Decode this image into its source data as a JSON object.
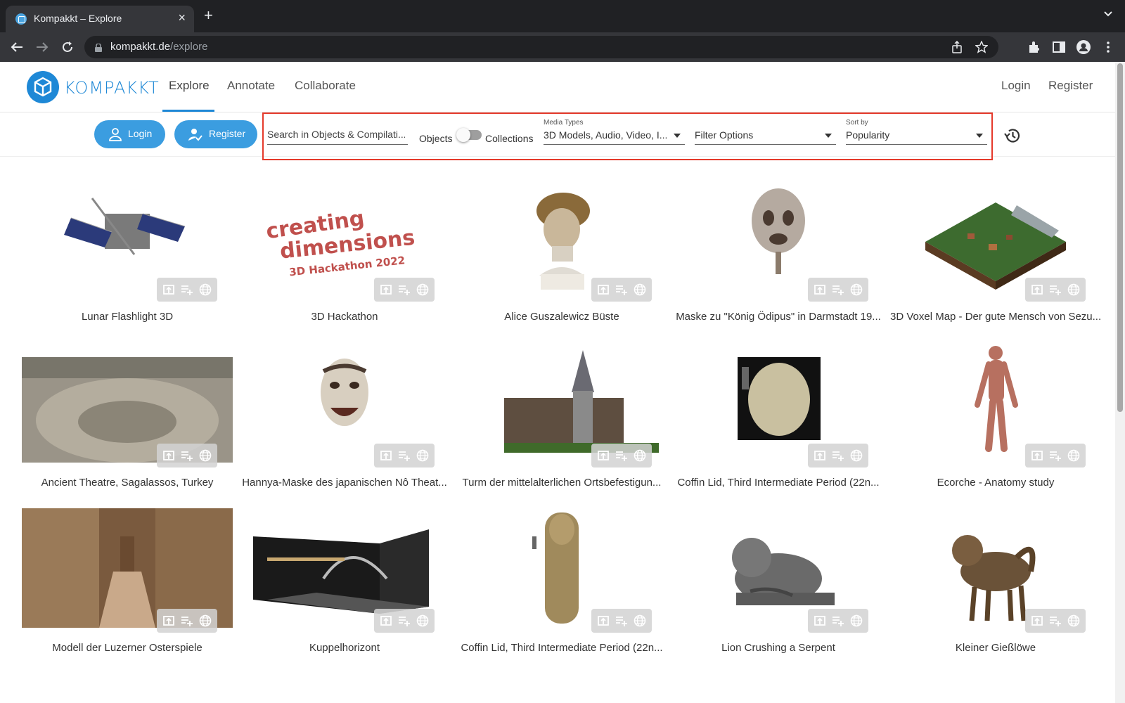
{
  "browser": {
    "tab_title": "Kompakkt – Explore",
    "url_host": "kompakkt.de",
    "url_path": "/explore"
  },
  "header": {
    "logo_text": "KOMPAKKT",
    "nav": [
      "Explore",
      "Annotate",
      "Collaborate"
    ],
    "login": "Login",
    "register": "Register"
  },
  "filters": {
    "login_button": "Login",
    "register_button": "Register",
    "search_placeholder": "Search in Objects & Compilati...",
    "toggle_left": "Objects",
    "toggle_right": "Collections",
    "media_types_label": "Media Types",
    "media_types_value": "3D Models, Audio, Video, I...",
    "filter_options_value": "Filter Options",
    "sort_by_label": "Sort by",
    "sort_by_value": "Popularity"
  },
  "items": [
    {
      "title": "Lunar Flashlight 3D",
      "thumb": "satellite"
    },
    {
      "title": "3D Hackathon",
      "thumb": "hackathon"
    },
    {
      "title": "Alice Guszalewicz Büste",
      "thumb": "bust"
    },
    {
      "title": "Maske zu \"König Ödipus\" in Darmstadt 19...",
      "thumb": "mask-oedipus"
    },
    {
      "title": "3D Voxel Map - Der gute Mensch von Sezu...",
      "thumb": "voxel-map"
    },
    {
      "title": "Ancient Theatre, Sagalassos, Turkey",
      "thumb": "theatre"
    },
    {
      "title": "Hannya-Maske des japanischen Nô Theat...",
      "thumb": "hannya-mask"
    },
    {
      "title": "Turm der mittelalterlichen Ortsbefestigun...",
      "thumb": "tower"
    },
    {
      "title": "Coffin Lid, Third Intermediate Period (22n...",
      "thumb": "coffin-lid-panel"
    },
    {
      "title": "Ecorche - Anatomy study",
      "thumb": "ecorche"
    },
    {
      "title": "Modell der Luzerner Osterspiele",
      "thumb": "luzern"
    },
    {
      "title": "Kuppelhorizont",
      "thumb": "kuppelhorizont"
    },
    {
      "title": "Coffin Lid, Third Intermediate Period (22n...",
      "thumb": "coffin-lid-standing"
    },
    {
      "title": "Lion Crushing a Serpent",
      "thumb": "lion"
    },
    {
      "title": "Kleiner Gießlöwe",
      "thumb": "aquamanile"
    }
  ]
}
